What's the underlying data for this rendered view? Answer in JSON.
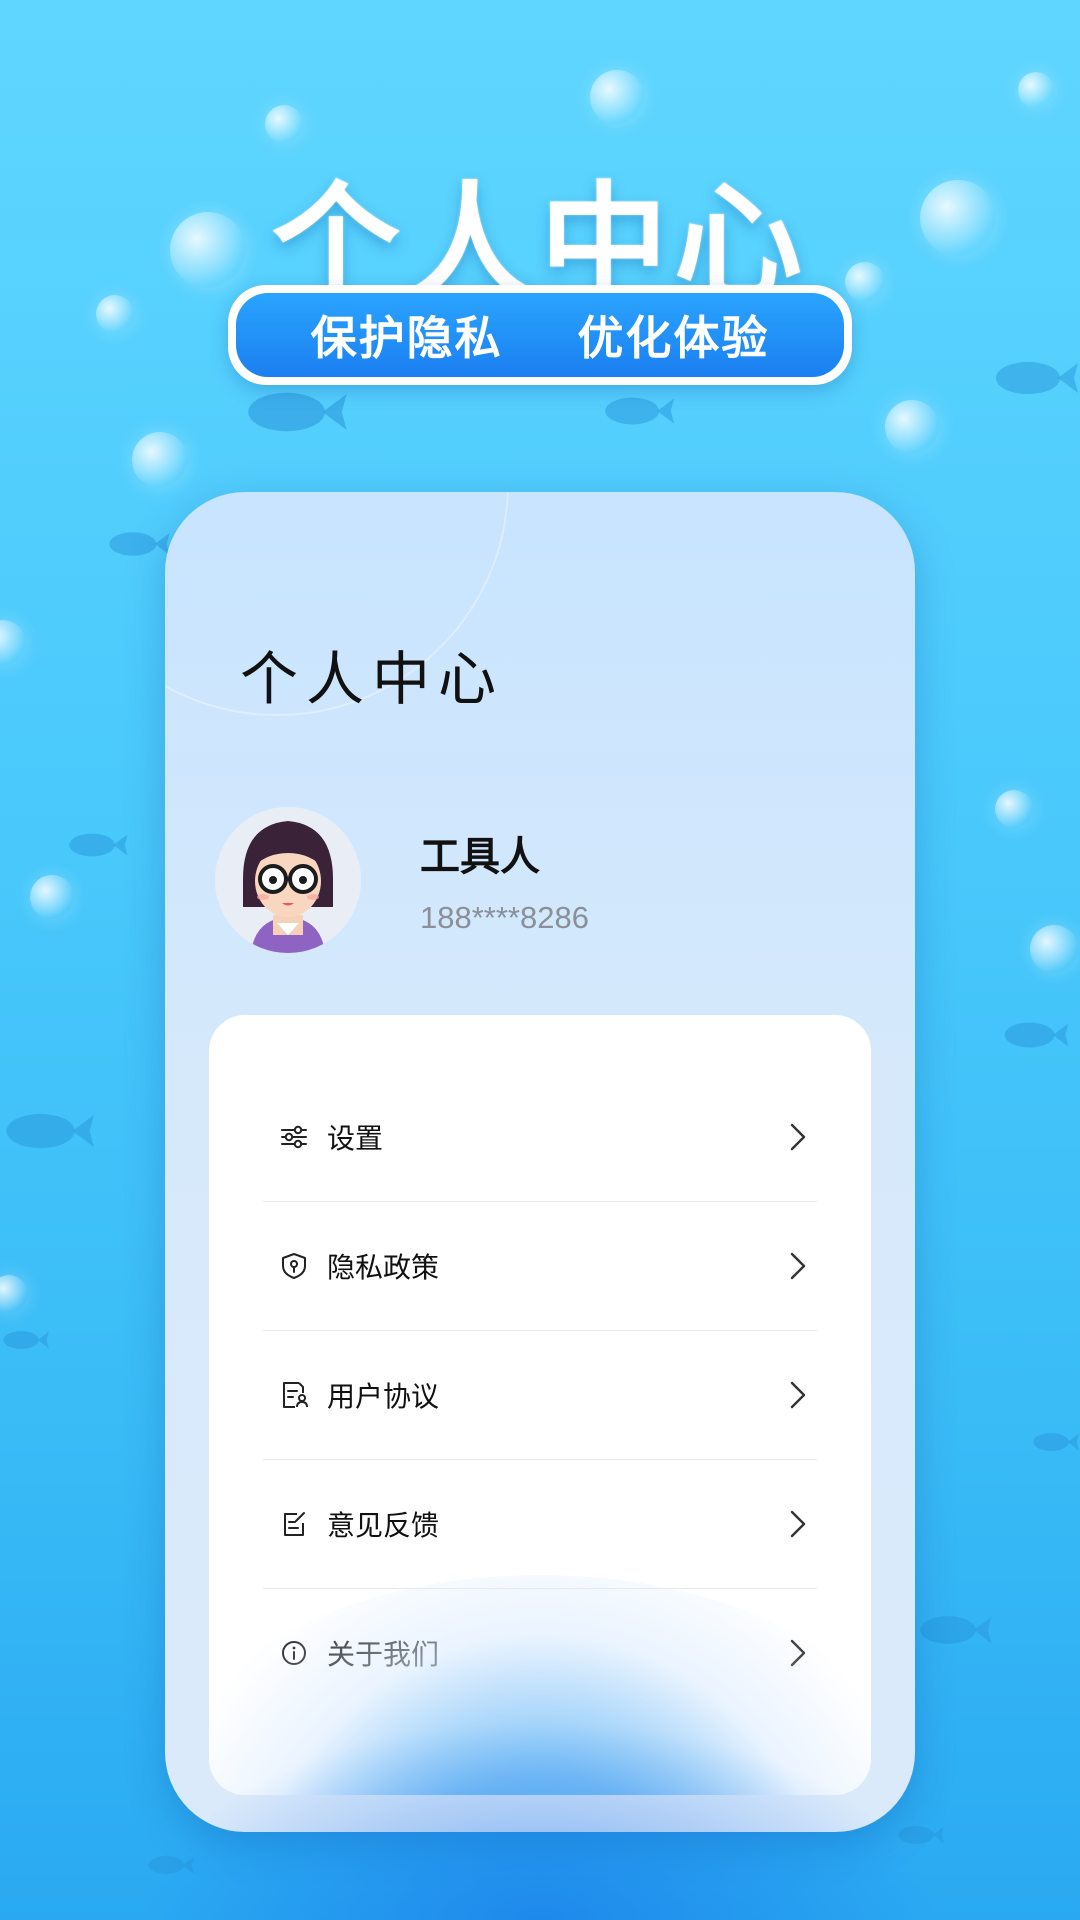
{
  "hero": {
    "title": "个人中心",
    "tag_left": "保护隐私",
    "tag_right": "优化体验"
  },
  "card": {
    "title": "个人中心"
  },
  "user": {
    "name": "工具人",
    "phone": "188****8286",
    "avatar_icon": "avatar-girl-glasses"
  },
  "menu": {
    "items": [
      {
        "label": "设置",
        "icon": "sliders-icon"
      },
      {
        "label": "隐私政策",
        "icon": "shield-lock-icon"
      },
      {
        "label": "用户协议",
        "icon": "document-user-icon"
      },
      {
        "label": "意见反馈",
        "icon": "edit-note-icon"
      },
      {
        "label": "关于我们",
        "icon": "info-icon"
      }
    ]
  },
  "colors": {
    "background": "#48c8fb",
    "accent": "#1b7ff0",
    "card": "#d6e9fb"
  }
}
